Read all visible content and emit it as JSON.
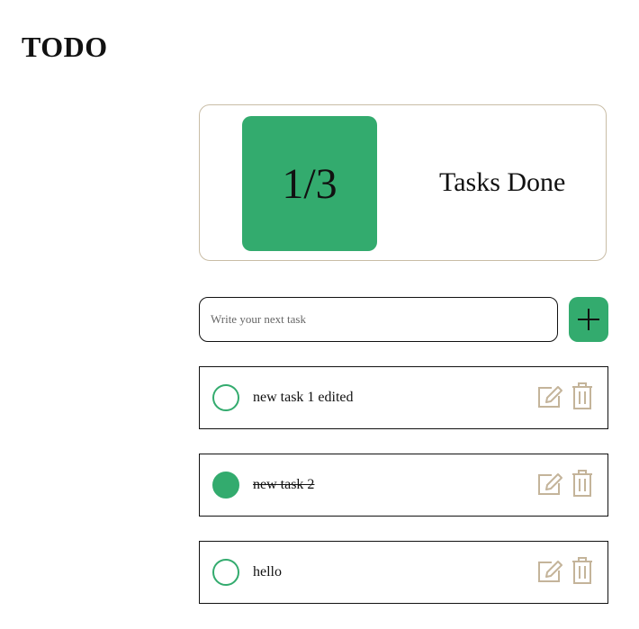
{
  "header": {
    "title": "TODO"
  },
  "summary": {
    "progress": "1/3",
    "label": "Tasks Done",
    "done_count": 1,
    "total_count": 3
  },
  "new_task": {
    "placeholder": "Write your next task",
    "value": ""
  },
  "add_button": {
    "icon": "plus-icon"
  },
  "tasks": [
    {
      "text": "new task 1 edited",
      "done": false
    },
    {
      "text": "new task 2",
      "done": true
    },
    {
      "text": "hello",
      "done": false
    }
  ],
  "icons": {
    "edit": "edit-icon",
    "delete": "trash-icon"
  },
  "colors": {
    "accent": "#33ab6e",
    "card_border": "#c9bda6",
    "icon": "#c4b49a"
  }
}
